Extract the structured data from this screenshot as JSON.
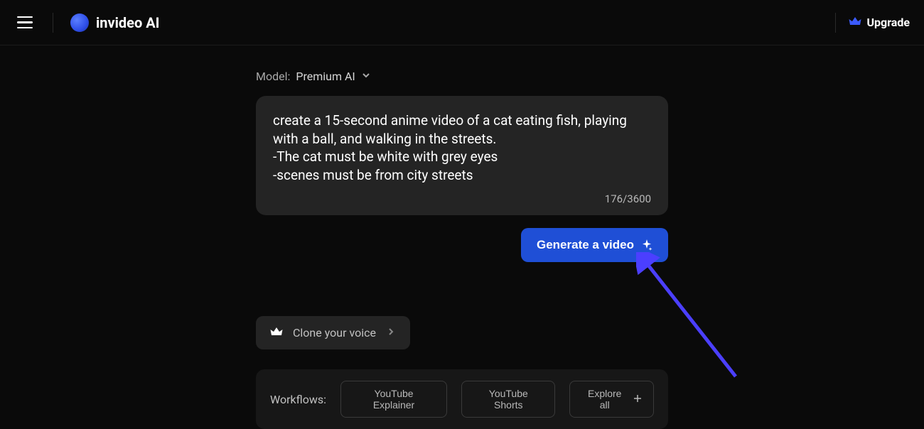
{
  "header": {
    "brand": "invideo AI",
    "upgrade_label": "Upgrade"
  },
  "model": {
    "label": "Model:",
    "value": "Premium AI"
  },
  "prompt": {
    "text": "create a 15-second anime video of a cat eating fish, playing with a ball, and walking in the streets.\n-The cat must be white with grey eyes\n-scenes must be from city streets",
    "char_count": "176/3600"
  },
  "generate": {
    "label": "Generate a video"
  },
  "clone_voice": {
    "label": "Clone your voice"
  },
  "workflows": {
    "label": "Workflows:",
    "items": [
      "YouTube Explainer",
      "YouTube Shorts",
      "Explore all"
    ]
  },
  "colors": {
    "accent": "#1f4fd6",
    "surface": "#242424",
    "bg": "#0a0a0a"
  }
}
